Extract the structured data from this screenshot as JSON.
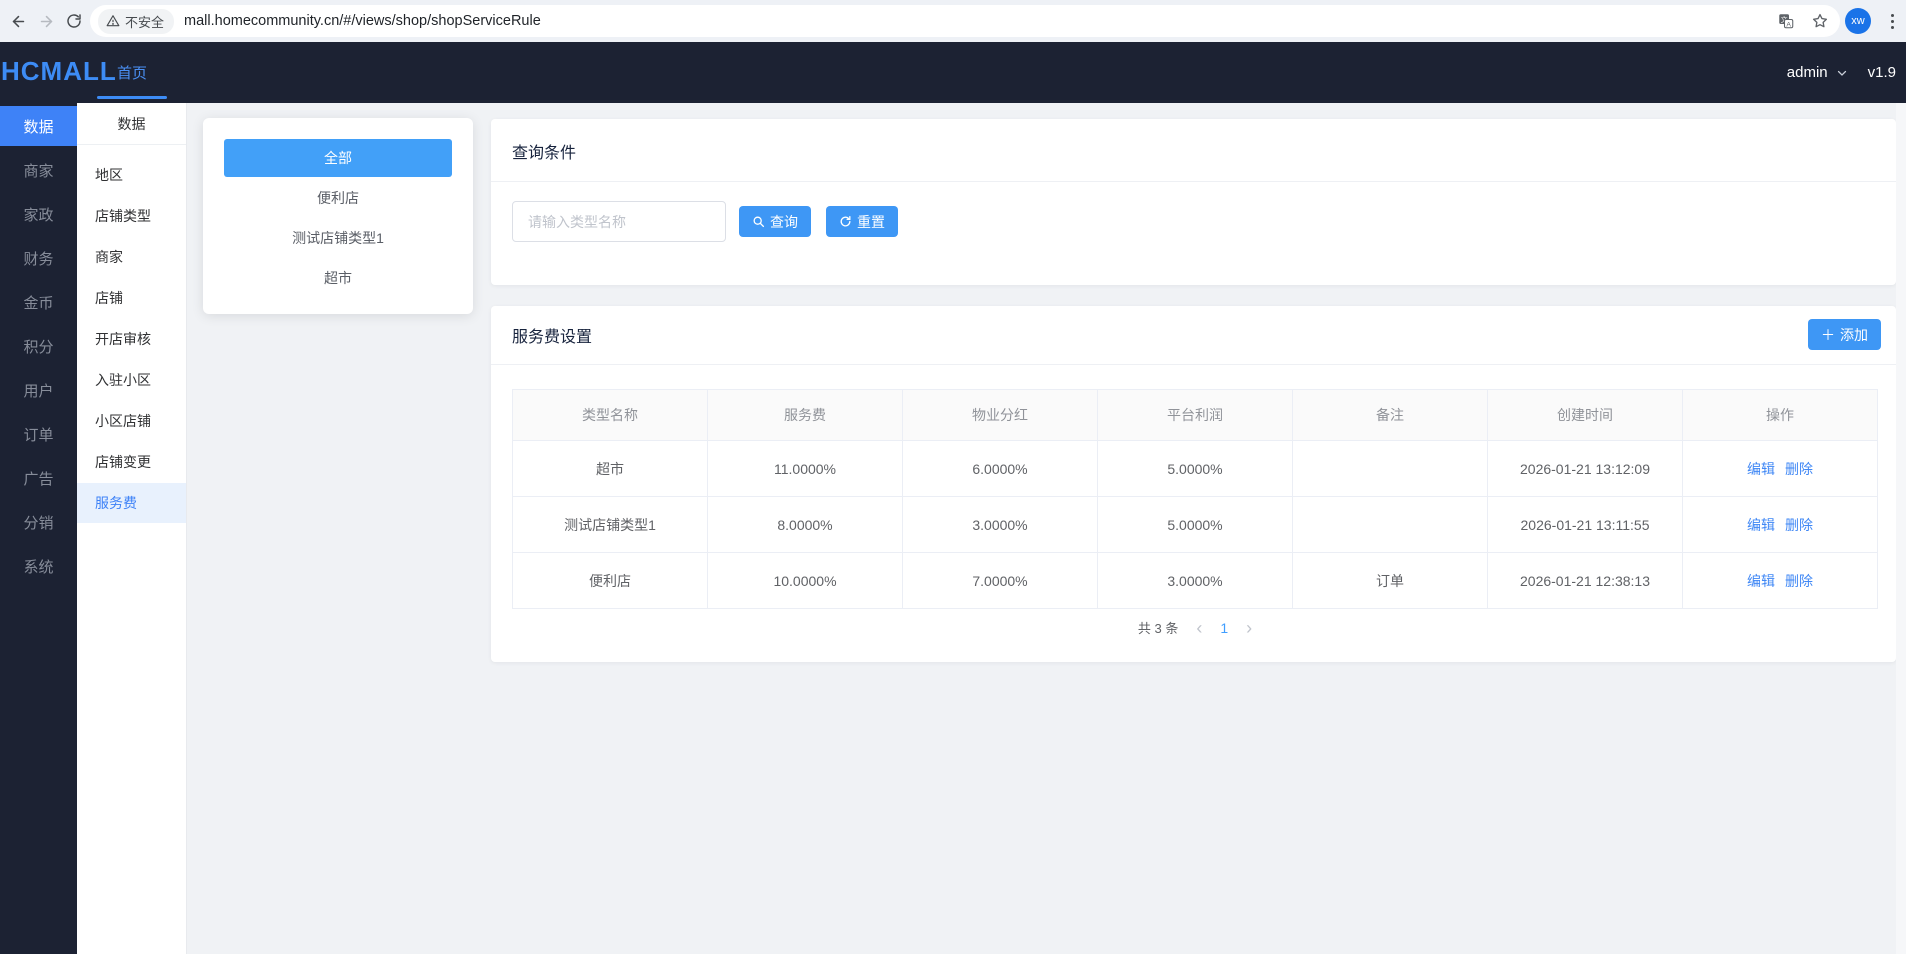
{
  "browser": {
    "security_label": "不安全",
    "url": "mall.homecommunity.cn/#/views/shop/shopServiceRule",
    "avatar_initials": "xw"
  },
  "navbar": {
    "logo": "HCMALL",
    "home_tab": "首页",
    "user": "admin",
    "version": "v1.9"
  },
  "sidebar": {
    "items": [
      "数据",
      "商家",
      "家政",
      "财务",
      "金币",
      "积分",
      "用户",
      "订单",
      "广告",
      "分销",
      "系统"
    ]
  },
  "submenu": {
    "title": "数据",
    "items": [
      "地区",
      "店铺类型",
      "商家",
      "店铺",
      "开店审核",
      "入驻小区",
      "小区店铺",
      "店铺变更",
      "服务费"
    ]
  },
  "type_panel": {
    "all_label": "全部",
    "items": [
      "便利店",
      "测试店铺类型1",
      "超市"
    ]
  },
  "query": {
    "title": "查询条件",
    "input_placeholder": "请输入类型名称",
    "search_label": "查询",
    "reset_label": "重置"
  },
  "table_card": {
    "title": "服务费设置",
    "add_icon": "＋",
    "add_label": "添加",
    "columns": [
      "类型名称",
      "服务费",
      "物业分红",
      "平台利润",
      "备注",
      "创建时间",
      "操作"
    ],
    "rows": [
      {
        "type": "超市",
        "fee": "11.0000%",
        "property_share": "6.0000%",
        "platform_profit": "5.0000%",
        "note": "",
        "created": "2026-01-21 13:12:09"
      },
      {
        "type": "测试店铺类型1",
        "fee": "8.0000%",
        "property_share": "3.0000%",
        "platform_profit": "5.0000%",
        "note": "",
        "created": "2026-01-21 13:11:55"
      },
      {
        "type": "便利店",
        "fee": "10.0000%",
        "property_share": "7.0000%",
        "platform_profit": "3.0000%",
        "note": "订单",
        "created": "2026-01-21 12:38:13"
      }
    ],
    "edit_label": "编辑",
    "delete_label": "删除",
    "pagination": {
      "total_text": "共 3 条",
      "prev_icon": "‹",
      "current_page": "1",
      "next_icon": "›"
    }
  },
  "colors": {
    "accent_blue": "#3e97f5",
    "active_blue": "#3e82f7",
    "link_blue": "#3f87f5",
    "navbar_dark": "#1c2233",
    "page_bg": "#f0f2f5"
  }
}
